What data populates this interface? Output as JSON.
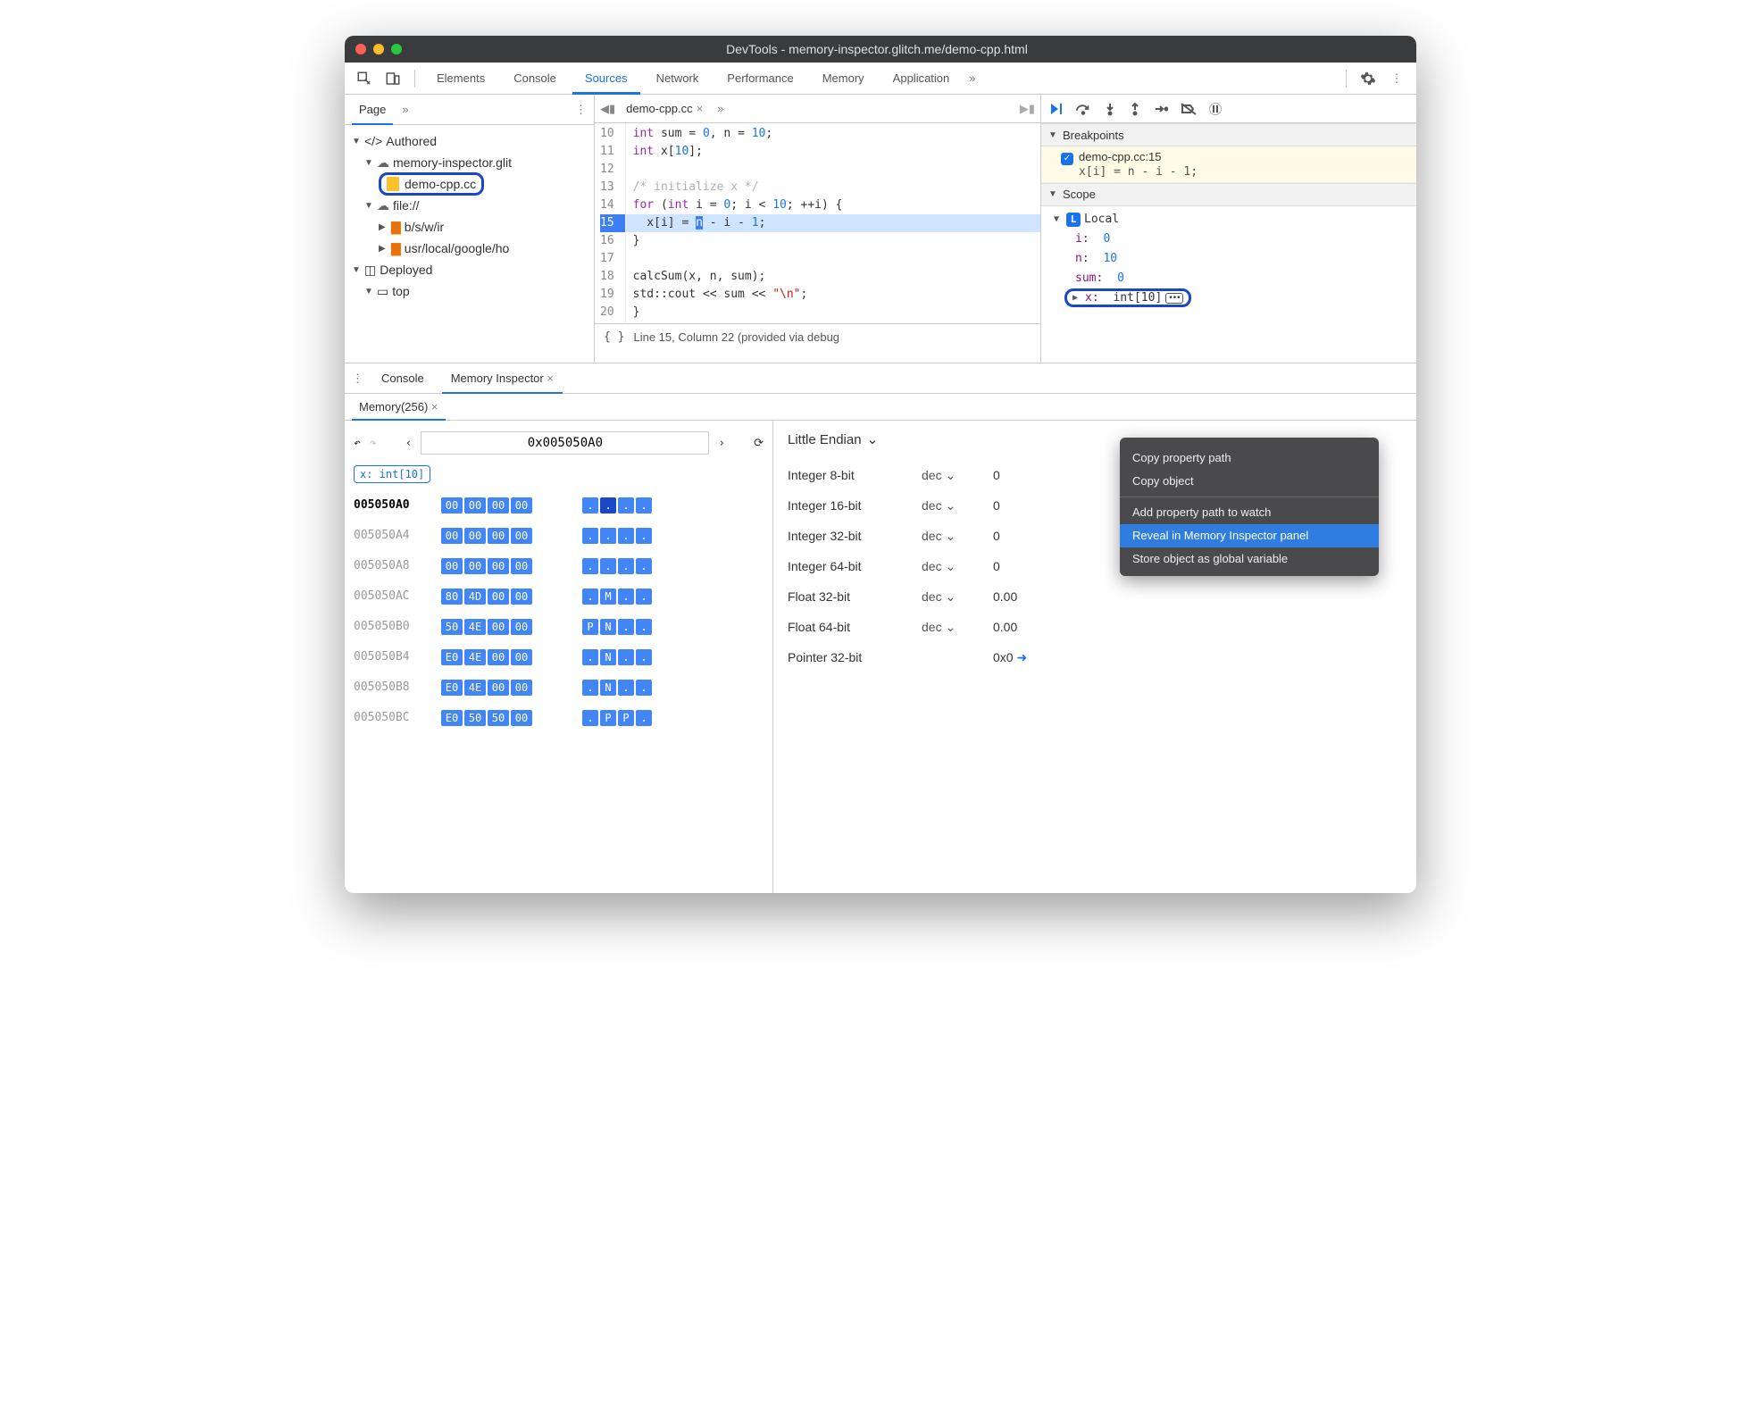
{
  "title": "DevTools - memory-inspector.glitch.me/demo-cpp.html",
  "mainTabs": {
    "elements": "Elements",
    "console": "Console",
    "sources": "Sources",
    "network": "Network",
    "performance": "Performance",
    "memory": "Memory",
    "application": "Application"
  },
  "sidebar": {
    "pageTab": "Page",
    "authored": "Authored",
    "host": "memory-inspector.glit",
    "file": "demo-cpp.cc",
    "fileProto": "file://",
    "folder1": "b/s/w/ir",
    "folder2": "usr/local/google/ho",
    "deployed": "Deployed",
    "top": "top"
  },
  "editor": {
    "fileTab": "demo-cpp.cc",
    "status": "Line 15, Column 22  (provided via debug",
    "lines": [
      "10",
      "11",
      "12",
      "13",
      "14",
      "15",
      "16",
      "17",
      "18",
      "19",
      "20"
    ]
  },
  "code": {
    "l10a": "int",
    "l10b": " sum = ",
    "l10c": "0",
    "l10d": ", n = ",
    "l10e": "10",
    "l10f": ";",
    "l11a": "int",
    "l11b": " x[",
    "l11c": "10",
    "l11d": "];",
    "l13": "/* initialize x */",
    "l14a": "for",
    "l14b": " (",
    "l14c": "int",
    "l14d": " i = ",
    "l14e": "0",
    "l14f": "; i < ",
    "l14g": "10",
    "l14h": "; ++i) {",
    "l15a": "  x[i] = ",
    "l15b": "n",
    "l15c": " - i - ",
    "l15d": "1",
    "l15e": ";",
    "l16": "}",
    "l18": "calcSum(x, n, sum);",
    "l19a": "std::cout << sum << ",
    "l19b": "\"\\n\"",
    "l19c": ";",
    "l20": "}"
  },
  "debugger": {
    "breakpoints": "Breakpoints",
    "bpFile": "demo-cpp.cc:15",
    "bpCode": "x[i] = n - i - 1;",
    "scope": "Scope",
    "local": "Local",
    "i_key": "i:",
    "i_val": "0",
    "n_key": "n:",
    "n_val": "10",
    "sum_key": "sum:",
    "sum_val": "0",
    "x_key": "x:",
    "x_val": "int[10]"
  },
  "drawer": {
    "console": "Console",
    "memInspector": "Memory Inspector",
    "memTab": "Memory(256)",
    "address": "0x005050A0",
    "chip": "x: int[10]",
    "endian": "Little Endian"
  },
  "hex": {
    "rows": [
      {
        "addr": "005050A0",
        "cur": true,
        "bytes": [
          "00",
          "00",
          "00",
          "00"
        ],
        "ascii": [
          ".",
          ".",
          ".",
          "."
        ]
      },
      {
        "addr": "005050A4",
        "cur": false,
        "bytes": [
          "00",
          "00",
          "00",
          "00"
        ],
        "ascii": [
          ".",
          ".",
          ".",
          "."
        ]
      },
      {
        "addr": "005050A8",
        "cur": false,
        "bytes": [
          "00",
          "00",
          "00",
          "00"
        ],
        "ascii": [
          ".",
          ".",
          ".",
          "."
        ]
      },
      {
        "addr": "005050AC",
        "cur": false,
        "bytes": [
          "80",
          "4D",
          "00",
          "00"
        ],
        "ascii": [
          ".",
          "M",
          ".",
          "."
        ]
      },
      {
        "addr": "005050B0",
        "cur": false,
        "bytes": [
          "50",
          "4E",
          "00",
          "00"
        ],
        "ascii": [
          "P",
          "N",
          ".",
          "."
        ]
      },
      {
        "addr": "005050B4",
        "cur": false,
        "bytes": [
          "E0",
          "4E",
          "00",
          "00"
        ],
        "ascii": [
          ".",
          "N",
          ".",
          "."
        ]
      },
      {
        "addr": "005050B8",
        "cur": false,
        "bytes": [
          "E0",
          "4E",
          "00",
          "00"
        ],
        "ascii": [
          ".",
          "N",
          ".",
          "."
        ]
      },
      {
        "addr": "005050BC",
        "cur": false,
        "bytes": [
          "E0",
          "50",
          "50",
          "00"
        ],
        "ascii": [
          ".",
          "P",
          "P",
          "."
        ]
      }
    ]
  },
  "types": {
    "i8": {
      "label": "Integer 8-bit",
      "fmt": "dec",
      "val": "0"
    },
    "i16": {
      "label": "Integer 16-bit",
      "fmt": "dec",
      "val": "0"
    },
    "i32": {
      "label": "Integer 32-bit",
      "fmt": "dec",
      "val": "0"
    },
    "i64": {
      "label": "Integer 64-bit",
      "fmt": "dec",
      "val": "0"
    },
    "f32": {
      "label": "Float 32-bit",
      "fmt": "dec",
      "val": "0.00"
    },
    "f64": {
      "label": "Float 64-bit",
      "fmt": "dec",
      "val": "0.00"
    },
    "p32": {
      "label": "Pointer 32-bit",
      "fmt": "",
      "val": "0x0"
    }
  },
  "menu": {
    "copyPath": "Copy property path",
    "copyObj": "Copy object",
    "addWatch": "Add property path to watch",
    "reveal": "Reveal in Memory Inspector panel",
    "store": "Store object as global variable"
  }
}
